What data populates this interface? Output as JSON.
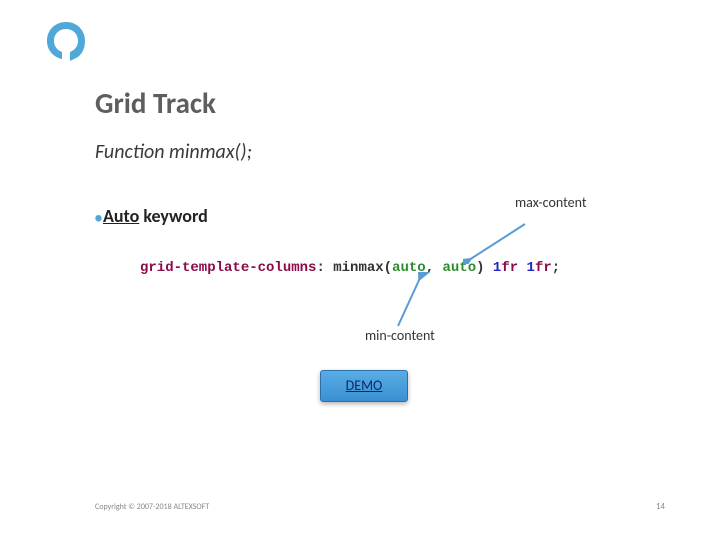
{
  "title": "Grid Track",
  "subtitle": "Function minmax();",
  "bullet": {
    "kw": "Auto",
    "rest": " keyword"
  },
  "code": {
    "prop": "grid-template-columns",
    "func": "minmax",
    "arg1": "auto",
    "arg2": "auto",
    "tail_num1": "1",
    "tail_unit1": "fr",
    "tail_num2": "1",
    "tail_unit2": "fr"
  },
  "annotations": {
    "max": "max-content",
    "min": "min-content"
  },
  "demo": "DEMO",
  "footer": {
    "copyright": "Copyright © 2007-2018 ALTEXSOFT",
    "page": "14"
  }
}
